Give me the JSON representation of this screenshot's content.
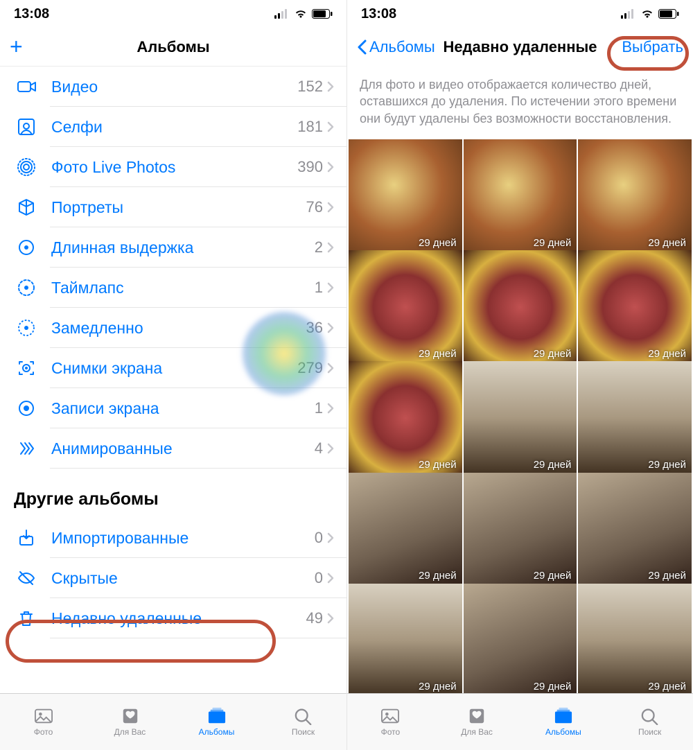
{
  "status": {
    "time": "13:08"
  },
  "left": {
    "title": "Альбомы",
    "albums": [
      {
        "label": "Видео",
        "count": 152,
        "icon": "video"
      },
      {
        "label": "Селфи",
        "count": 181,
        "icon": "selfie"
      },
      {
        "label": "Фото Live Photos",
        "count": 390,
        "icon": "live"
      },
      {
        "label": "Портреты",
        "count": 76,
        "icon": "cube"
      },
      {
        "label": "Длинная выдержка",
        "count": 2,
        "icon": "longexp"
      },
      {
        "label": "Таймлапс",
        "count": 1,
        "icon": "timelapse"
      },
      {
        "label": "Замедленно",
        "count": 36,
        "icon": "slomo"
      },
      {
        "label": "Снимки экрана",
        "count": 279,
        "icon": "screenshot"
      },
      {
        "label": "Записи экрана",
        "count": 1,
        "icon": "record"
      },
      {
        "label": "Анимированные",
        "count": 4,
        "icon": "animated"
      }
    ],
    "other_section": "Другие альбомы",
    "other": [
      {
        "label": "Импортированные",
        "count": 0,
        "icon": "import"
      },
      {
        "label": "Скрытые",
        "count": 0,
        "icon": "hidden"
      },
      {
        "label": "Недавно удаленные",
        "count": 49,
        "icon": "trash"
      }
    ]
  },
  "right": {
    "back": "Альбомы",
    "title": "Недавно удаленные",
    "select": "Выбрать",
    "desc": "Для фото и видео отображается количество дней, оставшихся до удаления. По истечении этого времени они будут удалены без возможности восстановления.",
    "days_label": "29 дней",
    "thumbs": [
      "food1",
      "food1",
      "food1",
      "food2",
      "food2",
      "food2",
      "food2",
      "room",
      "room",
      "room2",
      "room2",
      "room2",
      "room",
      "room2",
      "room"
    ]
  },
  "tabs": [
    {
      "label": "Фото"
    },
    {
      "label": "Для Вас"
    },
    {
      "label": "Альбомы"
    },
    {
      "label": "Поиск"
    }
  ]
}
